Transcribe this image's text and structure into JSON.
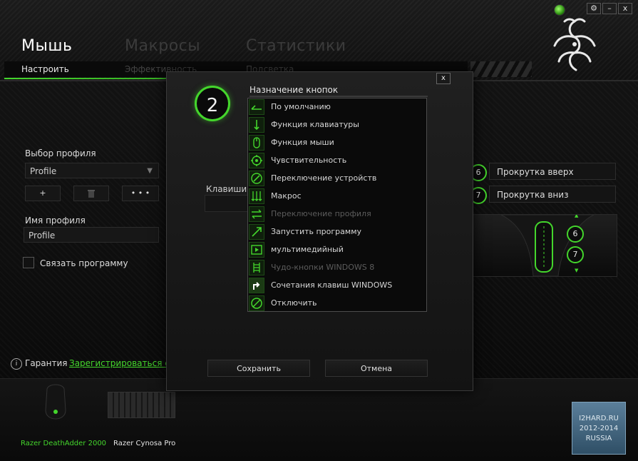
{
  "header": {
    "tabs": [
      {
        "label": "Мышь",
        "active": true
      },
      {
        "label": "Макросы",
        "active": false
      },
      {
        "label": "Статистики",
        "active": false
      }
    ],
    "subtabs": [
      {
        "label": "Настроить",
        "active": true
      },
      {
        "label": "Эффективность",
        "active": false
      },
      {
        "label": "Подсветка",
        "active": false
      }
    ],
    "window_controls": {
      "settings": "⚙",
      "minimize": "–",
      "close": "x"
    }
  },
  "profile": {
    "select_label": "Выбор профиля",
    "selected": "Profile",
    "add_button": "+",
    "delete_button": "🗑",
    "more_button": "• • •",
    "name_label": "Имя профиля",
    "name_value": "Profile",
    "link_program_label": "Связать программу"
  },
  "footer": {
    "warranty_label": "Гарантия",
    "register_link": "Зарегистрироваться сей"
  },
  "button_assignments": [
    {
      "num": "6",
      "label": "Прокрутка вверх"
    },
    {
      "num": "7",
      "label": "Прокрутка вниз"
    }
  ],
  "mouse_preview": {
    "buttons": [
      "6",
      "7"
    ]
  },
  "devices": [
    {
      "name": "Razer DeathAdder 2000",
      "active": true
    },
    {
      "name": "Razer Cynosa Pro",
      "active": false
    }
  ],
  "watermark": {
    "line1": "I2HARD.RU",
    "line2": "2012-2014",
    "line3": "RUSSIA"
  },
  "modal": {
    "close": "x",
    "button_number": "2",
    "title": "Назначение кнопок",
    "background_label": "Клавиши п",
    "menu": [
      {
        "label": "По умолчанию",
        "icon": "default-icon",
        "disabled": false
      },
      {
        "label": "Функция клавиатуры",
        "icon": "keyboard-function-icon",
        "disabled": false
      },
      {
        "label": "Функция мыши",
        "icon": "mouse-function-icon",
        "disabled": false
      },
      {
        "label": "Чувствительность",
        "icon": "sensitivity-icon",
        "disabled": false
      },
      {
        "label": "Переключение устройств",
        "icon": "device-switch-icon",
        "disabled": false
      },
      {
        "label": "Макрос",
        "icon": "macro-icon",
        "disabled": false
      },
      {
        "label": "Переключение профиля",
        "icon": "profile-switch-icon",
        "disabled": true
      },
      {
        "label": "Запустить программу",
        "icon": "launch-program-icon",
        "disabled": false
      },
      {
        "label": "мультимедийный",
        "icon": "multimedia-icon",
        "disabled": false
      },
      {
        "label": "Чудо-кнопки WINDOWS 8",
        "icon": "windows8-charms-icon",
        "disabled": true
      },
      {
        "label": "Сочетания клавиш WINDOWS",
        "icon": "windows-shortcut-icon",
        "disabled": false
      },
      {
        "label": "Отключить",
        "icon": "disable-icon",
        "disabled": false
      }
    ],
    "save_button": "Сохранить",
    "cancel_button": "Отмена"
  },
  "colors": {
    "accent": "#44d62c",
    "background": "#0b0b0b",
    "disabled_text": "#5c5c5c"
  }
}
